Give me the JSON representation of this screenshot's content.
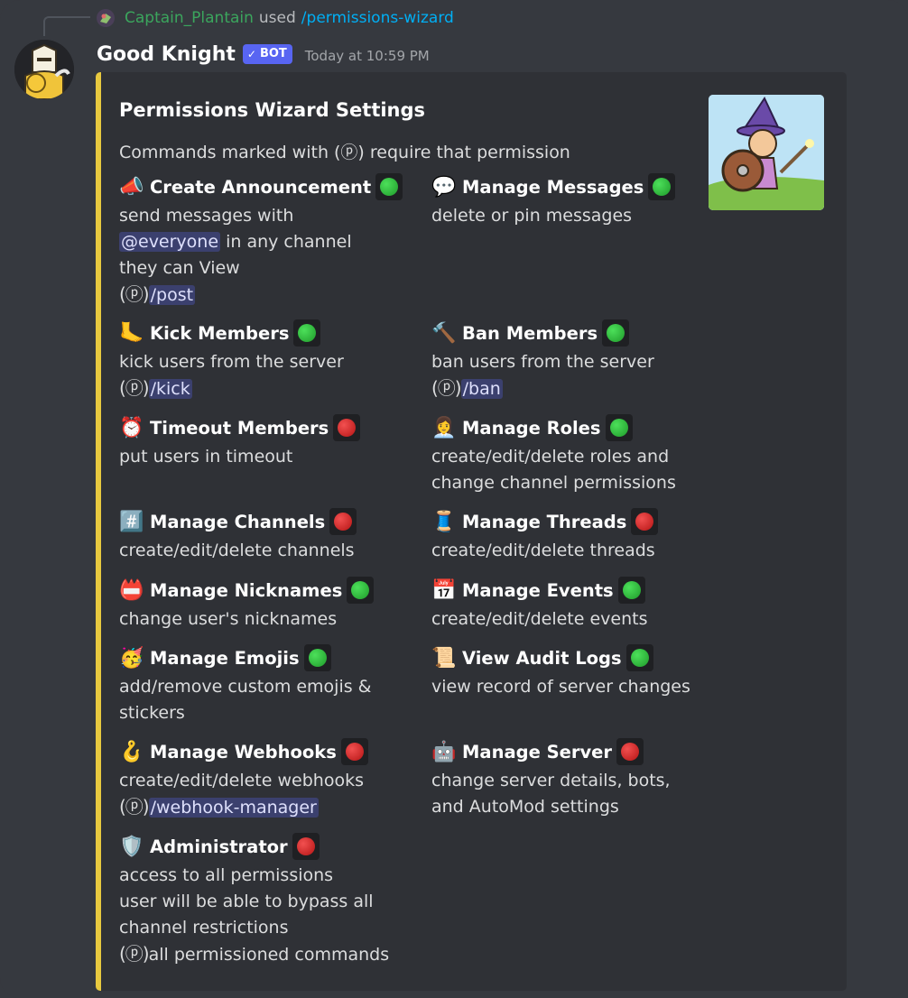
{
  "reply": {
    "user": "Captain_Plantain",
    "used": "used",
    "command": "/permissions-wizard"
  },
  "message": {
    "bot_name": "Good Knight",
    "bot_tag": "BOT",
    "bot_tag_check": "✓",
    "timestamp": "Today at 10:59 PM"
  },
  "embed": {
    "accent_color": "#e8c93f",
    "title": "Permissions Wizard Settings",
    "description": "Commands marked with (ⓟ) require that permission",
    "fields": [
      {
        "icon": "megaphone-icon",
        "emoji": "📣",
        "name": "Create Announcement",
        "status": "green",
        "lines": [
          "send messages with",
          "@everyone in any channel",
          "they can View",
          "(ⓟ)/post"
        ]
      },
      {
        "icon": "speech-bubble-icon",
        "emoji": "💬",
        "name": "Manage Messages",
        "status": "green",
        "lines": [
          "delete or pin messages"
        ]
      },
      {
        "icon": "foot-icon",
        "emoji": "🦶",
        "name": "Kick Members",
        "status": "green",
        "lines": [
          "kick users from the server",
          "(ⓟ)/kick"
        ]
      },
      {
        "icon": "hammer-icon",
        "emoji": "🔨",
        "name": "Ban Members",
        "status": "green",
        "lines": [
          "ban users from the server",
          "(ⓟ)/ban"
        ]
      },
      {
        "icon": "alarm-clock-icon",
        "emoji": "⏰",
        "name": "Timeout Members",
        "status": "red",
        "lines": [
          "put users in timeout"
        ]
      },
      {
        "icon": "office-worker-icon",
        "emoji": "👩‍💼",
        "name": "Manage Roles",
        "status": "green",
        "lines": [
          "create/edit/delete roles and",
          "change channel permissions"
        ]
      },
      {
        "icon": "hash-icon",
        "emoji": "#️⃣",
        "name": "Manage Channels",
        "status": "red",
        "lines": [
          "create/edit/delete channels"
        ]
      },
      {
        "icon": "thread-spool-icon",
        "emoji": "🧵",
        "name": "Manage Threads",
        "status": "red",
        "lines": [
          "create/edit/delete threads"
        ]
      },
      {
        "icon": "name-badge-icon",
        "emoji": "📛",
        "name": "Manage Nicknames",
        "status": "green",
        "lines": [
          "change user's nicknames"
        ]
      },
      {
        "icon": "calendar-icon",
        "emoji": "📅",
        "name": "Manage Events",
        "status": "green",
        "lines": [
          "create/edit/delete events"
        ]
      },
      {
        "icon": "party-face-icon",
        "emoji": "🥳",
        "name": "Manage Emojis",
        "status": "green",
        "lines": [
          "add/remove custom emojis &",
          "stickers"
        ]
      },
      {
        "icon": "scroll-icon",
        "emoji": "📜",
        "name": "View Audit Logs",
        "status": "green",
        "lines": [
          "view record of server changes"
        ]
      },
      {
        "icon": "hook-icon",
        "emoji": "🪝",
        "name": "Manage Webhooks",
        "status": "red",
        "lines": [
          "create/edit/delete webhooks",
          "(ⓟ)/webhook-manager"
        ]
      },
      {
        "icon": "robot-icon",
        "emoji": "🤖",
        "name": "Manage Server",
        "status": "red",
        "lines": [
          "change server details, bots,",
          "and AutoMod settings"
        ]
      },
      {
        "icon": "shield-icon",
        "emoji": "🛡️",
        "name": "Administrator",
        "status": "red",
        "lines": [
          "access to all permissions",
          "user will be able to bypass all",
          "channel restrictions",
          "(ⓟ)all permissioned commands"
        ]
      }
    ]
  },
  "colors": {
    "background": "#36393f",
    "embed": "#2f3136",
    "username_green": "#3ba55d",
    "link_blue": "#00aff4",
    "bot_tag": "#5865f2"
  }
}
